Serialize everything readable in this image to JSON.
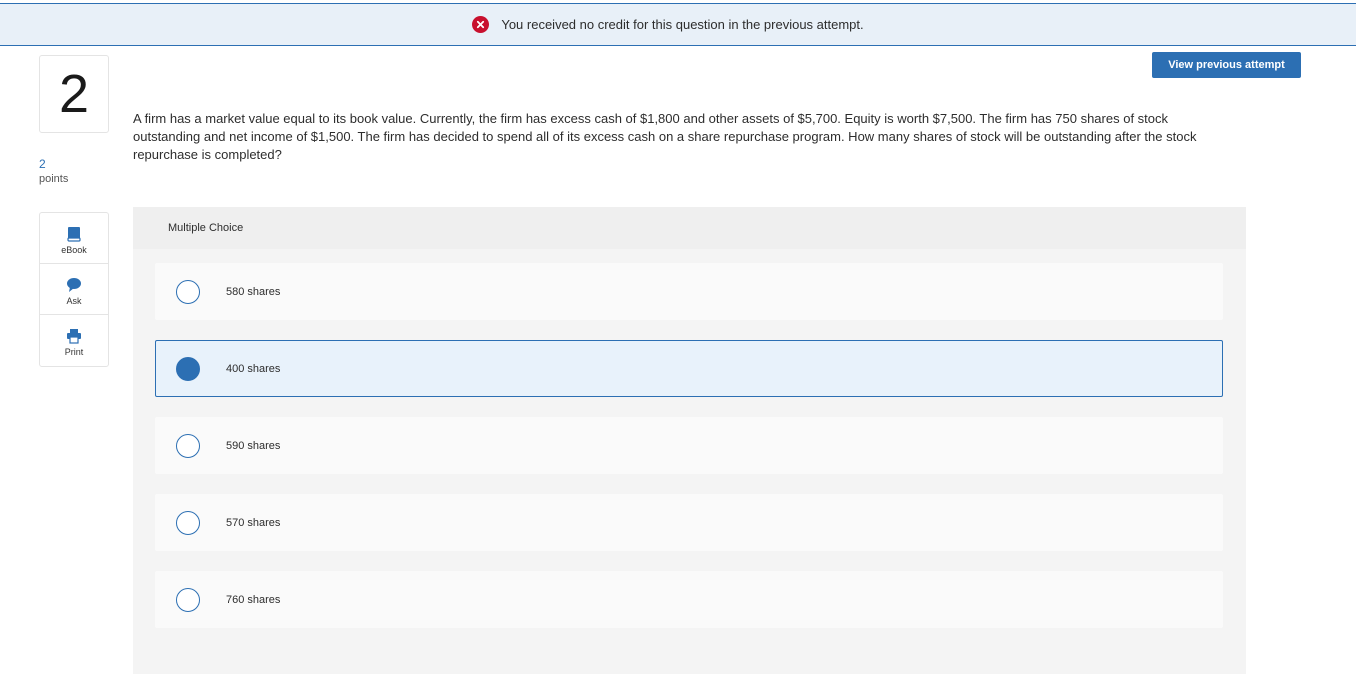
{
  "banner": {
    "message": "You received no credit for this question in the previous attempt."
  },
  "question": {
    "number": "2",
    "points_value": "2",
    "points_label": "points",
    "text": "A firm has a market value equal to its book value. Currently, the firm has excess cash of $1,800 and other assets of $5,700. Equity is worth $7,500. The firm has 750 shares of stock outstanding and net income of $1,500. The firm has decided to spend all of its excess cash on a share repurchase program. How many shares of stock will be outstanding after the stock repurchase is completed?"
  },
  "tools": {
    "ebook": "eBook",
    "ask": "Ask",
    "print": "Print"
  },
  "view_previous_label": "View previous attempt",
  "multiple_choice": {
    "header": "Multiple Choice",
    "options": [
      {
        "label": "580 shares",
        "selected": false
      },
      {
        "label": "400 shares",
        "selected": true
      },
      {
        "label": "590 shares",
        "selected": false
      },
      {
        "label": "570 shares",
        "selected": false
      },
      {
        "label": "760 shares",
        "selected": false
      }
    ]
  },
  "colors": {
    "accent": "#2c6fb3",
    "error": "#c8102e",
    "banner_bg": "#e8f0f8"
  }
}
